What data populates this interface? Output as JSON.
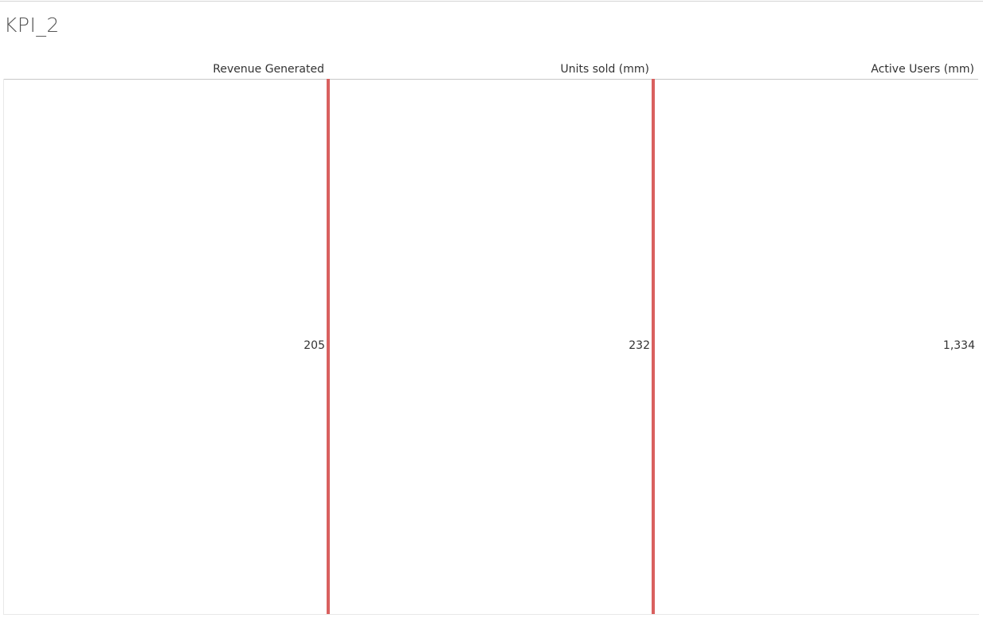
{
  "sheet": {
    "title": "KPI_2"
  },
  "kpis": [
    {
      "label": "Revenue Generated",
      "value": "205"
    },
    {
      "label": "Units sold (mm)",
      "value": "232"
    },
    {
      "label": "Active Users (mm)",
      "value": "1,334"
    }
  ],
  "colors": {
    "divider": "#d9605f",
    "text": "#333333",
    "title": "#555555",
    "header_rule": "#c8c8c8"
  }
}
